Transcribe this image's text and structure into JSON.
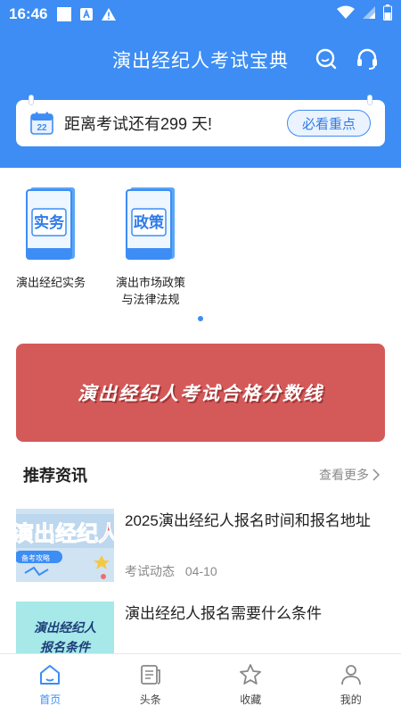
{
  "status_bar": {
    "time": "16:46"
  },
  "header": {
    "title": "演出经纪人考试宝典"
  },
  "countdown": {
    "calendar_day": "22",
    "text": "距离考试还有299 天!",
    "button": "必看重点"
  },
  "subjects": [
    {
      "cover_text": "实务",
      "label": "演出经纪实务"
    },
    {
      "cover_text": "政策",
      "label_line1": "演出市场政策",
      "label_line2": "与法律法规"
    }
  ],
  "banner": {
    "text": "演出经纪人考试合格分数线"
  },
  "news": {
    "section_title": "推荐资讯",
    "more": "查看更多",
    "items": [
      {
        "title": "2025演出经纪人报名时间和报名地址",
        "category": "考试动态",
        "date": "04-10",
        "thumb_text": "演出经纪人",
        "thumb_tag": "备考攻略"
      },
      {
        "title": "演出经纪人报名需要什么条件",
        "thumb_text_line1": "演出经纪人",
        "thumb_text_line2": "报名条件"
      }
    ]
  },
  "nav": [
    {
      "label": "首页",
      "icon": "home-icon",
      "active": true
    },
    {
      "label": "头条",
      "icon": "news-icon"
    },
    {
      "label": "收藏",
      "icon": "star-icon"
    },
    {
      "label": "我的",
      "icon": "user-icon"
    }
  ],
  "colors": {
    "primary": "#3d8df4",
    "banner": "#d45a5a",
    "text_muted": "#8a8a8a"
  }
}
